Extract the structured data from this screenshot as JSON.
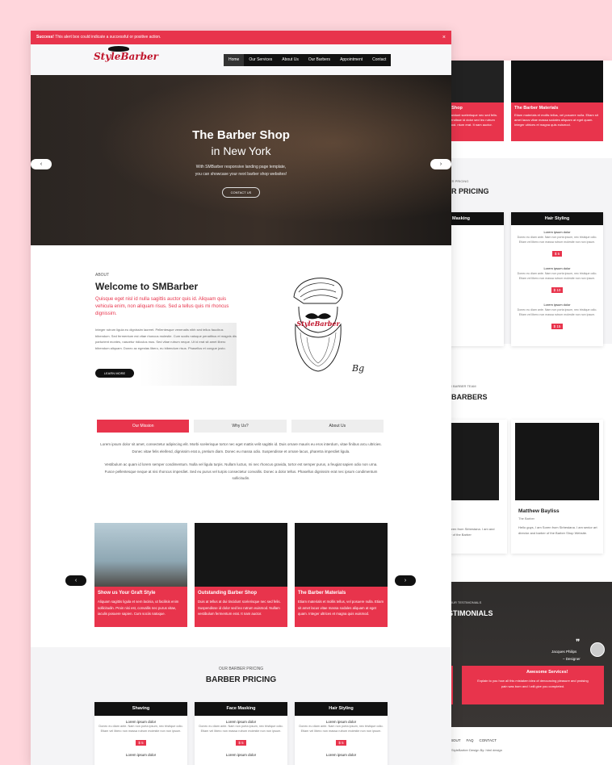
{
  "alert": {
    "strong": "Success!",
    "text": " This alert box could indicate a successful or positive action.",
    "close": "×"
  },
  "brand": {
    "logo_text": "StyleBarber"
  },
  "nav": {
    "items": [
      "Home",
      "Our Services",
      "About Us",
      "Our Barbers",
      "Appointment",
      "Contact"
    ]
  },
  "hero": {
    "title": "The Barber Shop",
    "subtitle": "in New York",
    "text_line1": "With SMBarber responsive landing page template,",
    "text_line2": "you can showcase your next barber shop websites!",
    "button": "CONTACT US",
    "prev": "‹",
    "next": "›"
  },
  "about": {
    "small": "ABOUT",
    "heading": "Welcome to SMBarber",
    "lead": "Quisque eget nisl id nulla sagittis auctor quis id. Aliquam quis vehicula enim, non aliquam risus. Sed a tellus quis mi rhoncus dignissim.",
    "body": "Integer rutrum ligula eu dignissim laoreet. Pellentesque venenatis nibh sed tellus faucibus bibendum. Sed fermentum est vitae rhoncus molestie. Cum sociis natoque penatibus et magnis dis parturient montes, nascetur ridiculus mus. Sed vitae rutrum neque. Ut id erat sit amet libero bibendum aliquam. Donec ac egestas libero, eu bibendum risus. Phasellus et congue justo.",
    "button": "LEARN MORE",
    "logo_text": "StyleBarber",
    "signature": "Bg"
  },
  "tabs": {
    "labels": [
      "Our Mission",
      "Why Us?",
      "About Us"
    ],
    "p1": "Lorem ipsum dolor sit amet, consectetur adipiscing elit. Morbi scelerisque tortor nec eget mattis velit sagittis id. Duis ornare mauris eu eros interdum, vitae finibus arcu ultricies. Donec vitae felis eleifend, dignissim erat a, pretium diam. Donec eu massa odio. Suspendisse et ornare lacus, pharetra imperdiet ligula.",
    "p2": "Vestibulum ac quam id lorem semper condimentum. Nulla vel ligula turpis. Nullam luctus, mi nec rhoncus gravida, tortor est semper purus, a feugiat sapien odio non urna. Fusce pellentesque neque at nisi rhoncus imperdiet. Sed eu purus vel turpis consectetur convallis. Donec a dolor tellus. Phasellus dignissim erat nec ipsum condimentum sollicitudin."
  },
  "services": {
    "prev": "‹",
    "next": "›",
    "cards": [
      {
        "title": "Show us Your Graft Style",
        "text": "Aliquam sagittis ligula et sem lacinia, ut facilisis enim sollicitudin. Proin nisi est, convallis nec purus vitae, iaculis posuere sapien. Cum sociis natoque."
      },
      {
        "title": "Outstanding Barber Shop",
        "text": "Duis at tellus at dui tincidunt scelerisque nec sed felis. Suspendisse id dolor sed leo rutrum euismod. Nullam vestibulum fermentum erat. It nam auctor."
      },
      {
        "title": "The Barber Materials",
        "text": "Etiam materials et mollis tellus, vel posuere nulla. Etiam sit amet lacus vitae massa sodales aliquam at eget quam. Integer ultrices et magna quis euismod."
      }
    ]
  },
  "pricing": {
    "sub": "OUR BARBER PRICING",
    "heading": "BARBER PRICING",
    "cards": [
      {
        "title": "Shaving",
        "items": [
          {
            "name": "Lorem ipsum dolor",
            "desc1": "Donec eu diam ante. Nam non porta ipsum, nec tristique odio.",
            "desc2": "Etiam vel libero non massa rutrum molestie non non ipsum.",
            "price": "$ 5"
          },
          {
            "name": "Lorem ipsum dolor",
            "desc1": "",
            "desc2": "",
            "price": ""
          }
        ]
      },
      {
        "title": "Face Masking",
        "items": [
          {
            "name": "Lorem ipsum dolor",
            "desc1": "Donec eu diam ante. Nam non porta ipsum, nec tristique odio.",
            "desc2": "Etiam vel libero non massa rutrum molestie non non ipsum.",
            "price": "$ 5"
          },
          {
            "name": "Lorem ipsum dolor",
            "desc1": "",
            "desc2": "",
            "price": ""
          }
        ]
      },
      {
        "title": "Hair Styling",
        "items": [
          {
            "name": "Lorem ipsum dolor",
            "desc1": "Donec eu diam ante. Nam non porta ipsum, nec tristique odio.",
            "desc2": "Etiam vel libero non massa rutrum molestie non non ipsum.",
            "price": "$ 5"
          },
          {
            "name": "Lorem ipsum dolor",
            "desc1": "",
            "desc2": "",
            "price": ""
          }
        ]
      }
    ]
  },
  "back": {
    "card1_title": "ber Shop",
    "card1_text": "dui tincidunt scelerisque nec sed felis. Suspendisse id dolor sed leo rutrum euismod. ntum erat. It nam auctor.",
    "card2_title": "The Barber Materials",
    "card2_text": "Etiam materials et mollis tellus, vel posuere nulla. Etiam sit amet lacus vitae massa sodales aliquam at eget quam. Integer ultrices et magna quis euismod.",
    "pricing_sub": "ER PRICING",
    "pricing_heading": "R PRICING",
    "price_card1_title": "Masking",
    "price_card2_title": "Hair Styling",
    "p_name": "Lorem ipsum dolor",
    "p_desc1": "Donec eu diam ante. Nam non porta ipsum, nec tristique odio.",
    "p_desc2": "Etiam vel libero non massa rutrum molestie non non ipsum.",
    "prices": [
      "$ 5",
      "$ 10",
      "$ 15"
    ],
    "team_sub": "R BARBER TEAM",
    "team_heading": "BARBERS",
    "barber_name": "Matthew Bayliss",
    "barber_role": "The Barber",
    "barber_text": "Hello guys, I am Soren from Sirbestana. I am senior art director and barber of the Barber Shop Website.",
    "barber1_text": "am Soren from Sirbestana. I am and barber of the Barber",
    "test_sub": "OUR TESTIMONIALS",
    "test_heading": "ESTIMONIALS",
    "quote_mark": "❞",
    "test_name": "Jacques Philips",
    "test_role": "– Designer",
    "test_title": "Awesome Services!",
    "test_text": "Explain to you how all this mistaken idea of denouncing pleasure and praising pain was born and I will give you completed.",
    "footer_links": [
      "ABOUT",
      "FAQ",
      "CONTACT"
    ],
    "copyright": "StyleBarber Design By: html design"
  }
}
